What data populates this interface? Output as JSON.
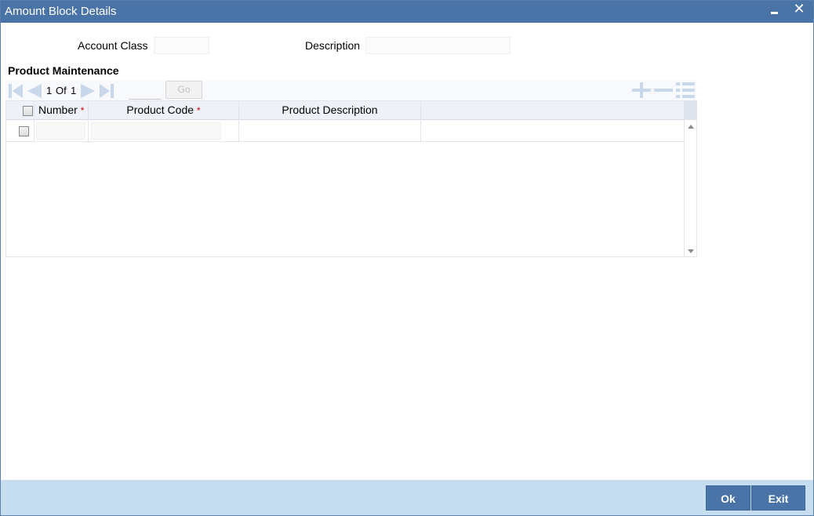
{
  "window": {
    "title": "Amount Block Details",
    "minimize_icon": "minimize-icon",
    "close_icon": "close-icon",
    "close_glyph": "✕"
  },
  "header_fields": {
    "account_class_label": "Account Class",
    "account_class_value": "",
    "description_label": "Description",
    "description_value": ""
  },
  "section": {
    "title": "Product Maintenance"
  },
  "pager": {
    "current": "1",
    "of_label": "Of",
    "total": "1",
    "page_input": "",
    "go_label": "Go",
    "icons": [
      "first-page-icon",
      "prev-page-icon",
      "next-page-icon",
      "last-page-icon",
      "add-row-icon",
      "delete-row-icon",
      "single-view-icon"
    ]
  },
  "grid": {
    "columns": [
      {
        "label": "Number",
        "required": true
      },
      {
        "label": "Product Code",
        "required": true
      },
      {
        "label": "Product Description",
        "required": false
      }
    ],
    "required_marker": "*",
    "rows": [
      {
        "checked": false,
        "number": "",
        "product_code": "",
        "product_description": ""
      }
    ]
  },
  "footer": {
    "ok_label": "Ok",
    "exit_label": "Exit"
  },
  "colors": {
    "titlebar": "#4a73a8",
    "footer": "#c6dcef",
    "button": "#4a73a8",
    "toolbar_icon": "#c9d7ea",
    "required_marker": "#cc0000"
  }
}
